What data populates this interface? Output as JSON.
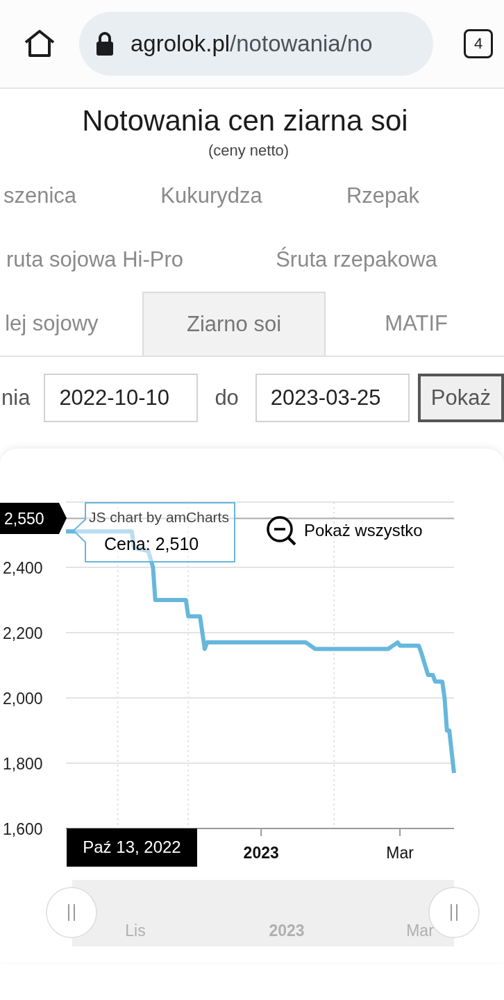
{
  "browser": {
    "url_host": "agrolok.pl",
    "url_path": "/notowania/no",
    "tab_count": "4"
  },
  "title": "Notowania cen ziarna soi",
  "subtitle": "(ceny netto)",
  "tab_rows": [
    [
      {
        "label": "szenica",
        "selected": false
      },
      {
        "label": "Kukurydza",
        "selected": false
      },
      {
        "label": "Rzepak",
        "selected": false
      }
    ],
    [
      {
        "label": "ruta sojowa Hi-Pro",
        "selected": false
      },
      {
        "label": "Śruta rzepakowa",
        "selected": false
      }
    ],
    [
      {
        "label": "lej sojowy",
        "selected": false
      },
      {
        "label": "Ziarno soi",
        "selected": true
      },
      {
        "label": "MATIF",
        "selected": false
      }
    ]
  ],
  "date_form": {
    "from_label": "nia",
    "from_value": "2022-10-10",
    "to_label": "do",
    "to_value": "2023-03-25",
    "button": "Pokaż"
  },
  "chart": {
    "credit": "JS chart by amCharts",
    "zoom_out_button": "Pokaż wszystko",
    "cursor_value": "2,550",
    "cursor_date": "Paź 13, 2022",
    "tooltip": "Cena: 2,510",
    "scrollbar_labels": [
      "Lis",
      "2023",
      "Mar"
    ],
    "chart_data": {
      "type": "line",
      "grid": true,
      "ref_lines": [
        {
          "axis": "y",
          "value": 2550
        }
      ],
      "xlim": [
        "2022-10-10",
        "2023-03-24"
      ],
      "ylim": [
        1600,
        2600
      ],
      "yticks": [
        {
          "value": 1600,
          "label": "1,600"
        },
        {
          "value": 1800,
          "label": "1,800"
        },
        {
          "value": 2000,
          "label": "2,000"
        },
        {
          "value": 2200,
          "label": "2,200"
        },
        {
          "value": 2400,
          "label": "2,400"
        }
      ],
      "xticks": [
        {
          "value": "2023-01-01",
          "label": "2023"
        },
        {
          "value": "2023-03-01",
          "label": "Mar"
        }
      ],
      "x": [
        "2022-10-10",
        "2022-11-07",
        "2022-11-08",
        "2022-11-14",
        "2022-11-16",
        "2022-11-17",
        "2022-11-30",
        "2022-12-01",
        "2022-12-06",
        "2022-12-07",
        "2022-12-08",
        "2022-12-09",
        "2023-01-20",
        "2023-01-24",
        "2023-02-24",
        "2023-02-28",
        "2023-03-01",
        "2023-03-09",
        "2023-03-10",
        "2023-03-13",
        "2023-03-15",
        "2023-03-16",
        "2023-03-19",
        "2023-03-20",
        "2023-03-21",
        "2023-03-22",
        "2023-03-24"
      ],
      "series": [
        {
          "color": "#67b7dc",
          "values": [
            2510,
            2510,
            2460,
            2450,
            2400,
            2300,
            2300,
            2250,
            2250,
            2200,
            2150,
            2170,
            2170,
            2150,
            2150,
            2170,
            2160,
            2160,
            2140,
            2070,
            2070,
            2050,
            2050,
            2000,
            1900,
            1900,
            1770
          ]
        }
      ]
    }
  }
}
